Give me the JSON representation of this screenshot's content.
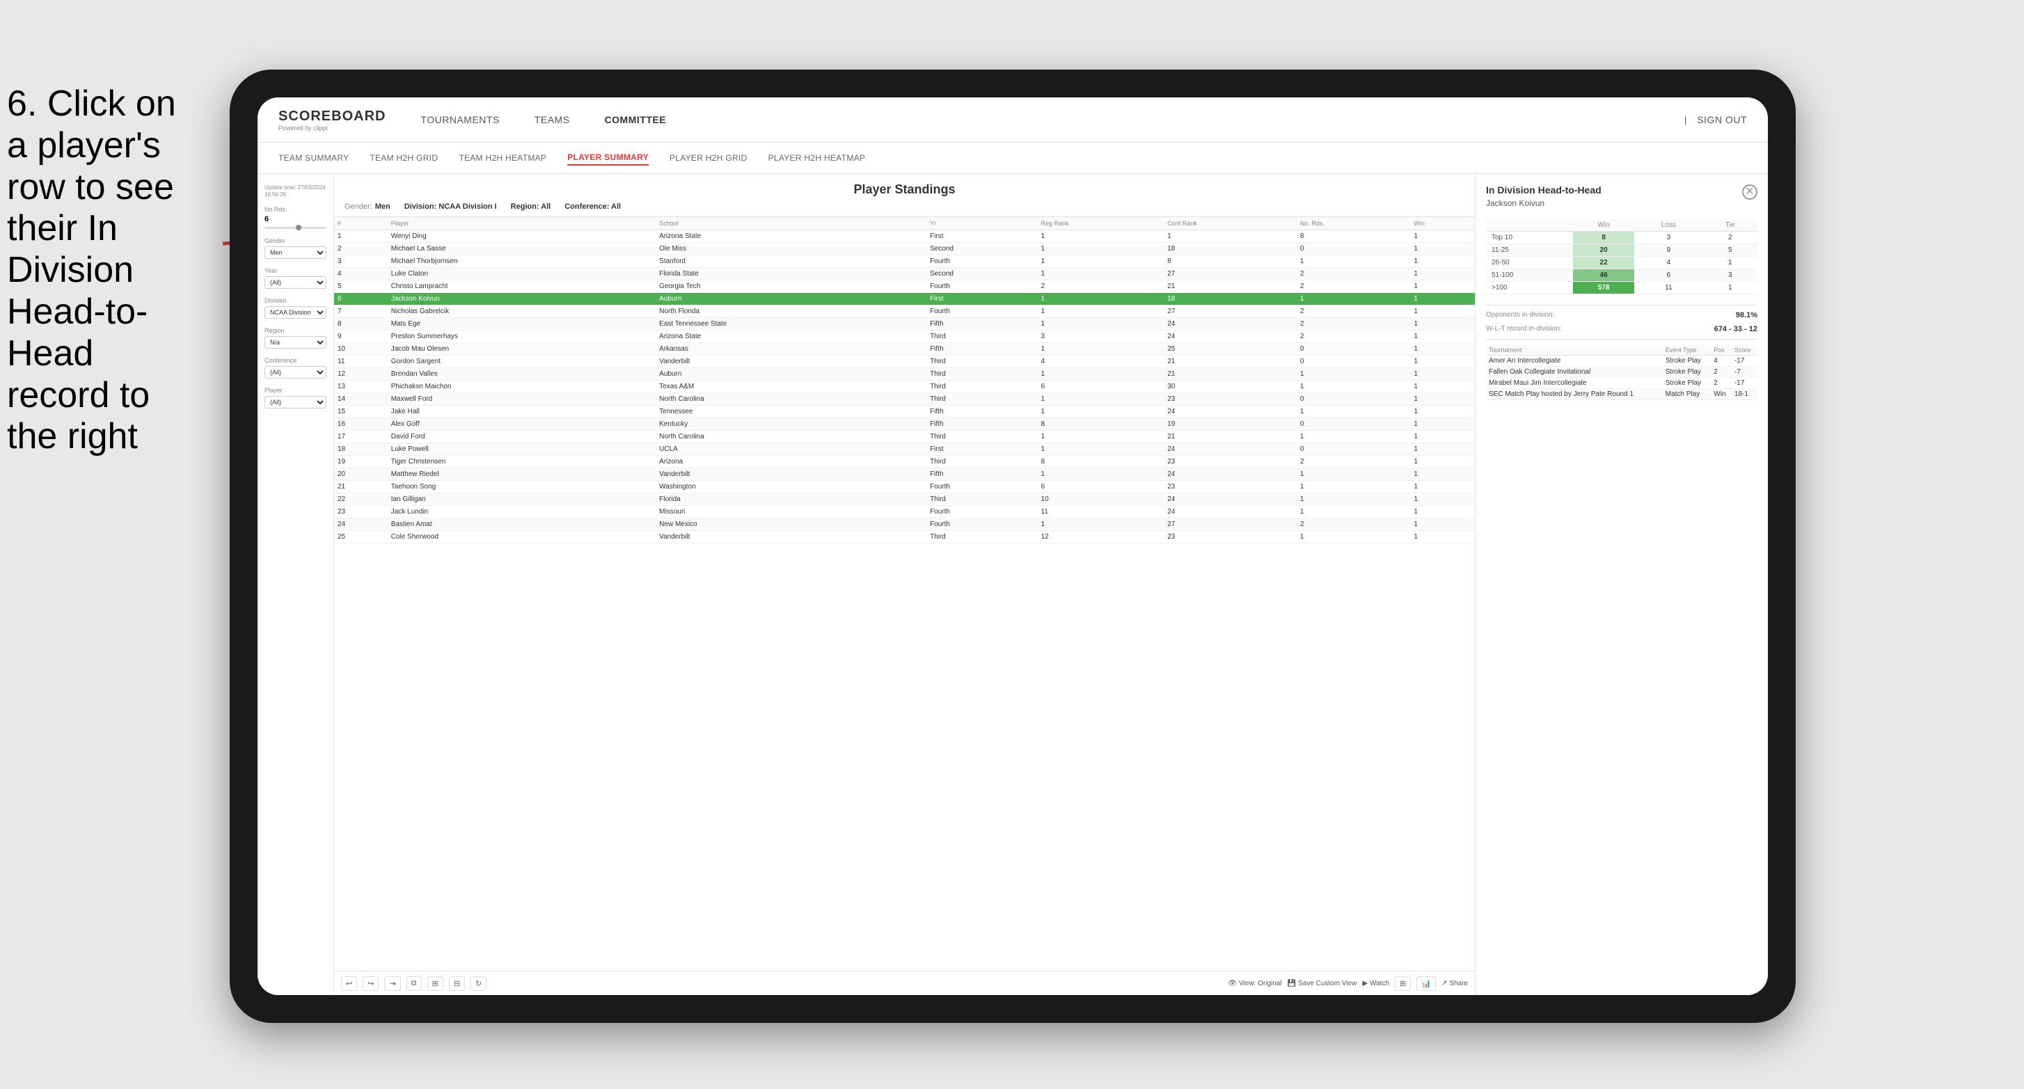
{
  "instruction": {
    "text": "6. Click on a player's row to see their In Division Head-to-Head record to the right"
  },
  "nav": {
    "logo": "SCOREBOARD",
    "logo_sub": "Powered by clippi",
    "items": [
      "TOURNAMENTS",
      "TEAMS",
      "COMMITTEE"
    ],
    "sign_in": "Sign out"
  },
  "sub_nav": {
    "items": [
      "TEAM SUMMARY",
      "TEAM H2H GRID",
      "TEAM H2H HEATMAP",
      "PLAYER SUMMARY",
      "PLAYER H2H GRID",
      "PLAYER H2H HEATMAP"
    ],
    "active": "PLAYER SUMMARY"
  },
  "filter": {
    "update_time": "Update time:\n27/03/2024 16:56:26",
    "no_rds_label": "No Rds.",
    "no_rds_value": "6",
    "gender_label": "Gender",
    "gender_value": "Men",
    "year_label": "Year",
    "year_value": "(All)",
    "division_label": "Division",
    "division_value": "NCAA Division I",
    "region_label": "Region",
    "region_value": "N/a",
    "conference_label": "Conference",
    "conference_value": "(All)",
    "player_label": "Player",
    "player_value": "(All)"
  },
  "standings": {
    "title": "Player Standings",
    "gender_label": "Gender:",
    "gender_value": "Men",
    "division_label": "Division: NCAA Division I",
    "region_label": "Region: All",
    "conference_label": "Conference: All",
    "columns": [
      "#",
      "Player",
      "School",
      "Yr",
      "Reg Rank",
      "Conf Rank",
      "No. Rds.",
      "Win"
    ],
    "rows": [
      {
        "num": 1,
        "player": "Wenyi Ding",
        "school": "Arizona State",
        "yr": "First",
        "reg": 1,
        "conf": 1,
        "rds": 8,
        "win": 1
      },
      {
        "num": 2,
        "player": "Michael La Sasse",
        "school": "Ole Miss",
        "yr": "Second",
        "reg": 1,
        "conf": 18,
        "rds": 0,
        "win": 1
      },
      {
        "num": 3,
        "player": "Michael Thorbjornsen",
        "school": "Stanford",
        "yr": "Fourth",
        "reg": 1,
        "conf": 8,
        "rds": 1,
        "win": 1
      },
      {
        "num": 4,
        "player": "Luke Claton",
        "school": "Florida State",
        "yr": "Second",
        "reg": 1,
        "conf": 27,
        "rds": 2,
        "win": 1
      },
      {
        "num": 5,
        "player": "Christo Lampracht",
        "school": "Georgia Tech",
        "yr": "Fourth",
        "reg": 2,
        "conf": 21,
        "rds": 2,
        "win": 1
      },
      {
        "num": 6,
        "player": "Jackson Koivun",
        "school": "Auburn",
        "yr": "First",
        "reg": 1,
        "conf": 18,
        "rds": 1,
        "win": 1,
        "highlighted": true
      },
      {
        "num": 7,
        "player": "Nicholas Gabrelcik",
        "school": "North Florida",
        "yr": "Fourth",
        "reg": 1,
        "conf": 27,
        "rds": 2,
        "win": 1
      },
      {
        "num": 8,
        "player": "Mats Ege",
        "school": "East Tennessee State",
        "yr": "Fifth",
        "reg": 1,
        "conf": 24,
        "rds": 2,
        "win": 1
      },
      {
        "num": 9,
        "player": "Preston Summerhays",
        "school": "Arizona State",
        "yr": "Third",
        "reg": 3,
        "conf": 24,
        "rds": 2,
        "win": 1
      },
      {
        "num": 10,
        "player": "Jacob Mau Olesen",
        "school": "Arkansas",
        "yr": "Fifth",
        "reg": 1,
        "conf": 25,
        "rds": 0,
        "win": 1
      },
      {
        "num": 11,
        "player": "Gordon Sargent",
        "school": "Vanderbilt",
        "yr": "Third",
        "reg": 4,
        "conf": 21,
        "rds": 0,
        "win": 1
      },
      {
        "num": 12,
        "player": "Brendan Valles",
        "school": "Auburn",
        "yr": "Third",
        "reg": 1,
        "conf": 21,
        "rds": 1,
        "win": 1
      },
      {
        "num": 13,
        "player": "Phichaksn Maichon",
        "school": "Texas A&M",
        "yr": "Third",
        "reg": 6,
        "conf": 30,
        "rds": 1,
        "win": 1
      },
      {
        "num": 14,
        "player": "Maxwell Ford",
        "school": "North Carolina",
        "yr": "Third",
        "reg": 1,
        "conf": 23,
        "rds": 0,
        "win": 1
      },
      {
        "num": 15,
        "player": "Jake Hall",
        "school": "Tennessee",
        "yr": "Fifth",
        "reg": 1,
        "conf": 24,
        "rds": 1,
        "win": 1
      },
      {
        "num": 16,
        "player": "Alex Goff",
        "school": "Kentucky",
        "yr": "Fifth",
        "reg": 8,
        "conf": 19,
        "rds": 0,
        "win": 1
      },
      {
        "num": 17,
        "player": "David Ford",
        "school": "North Carolina",
        "yr": "Third",
        "reg": 1,
        "conf": 21,
        "rds": 1,
        "win": 1
      },
      {
        "num": 18,
        "player": "Luke Powell",
        "school": "UCLA",
        "yr": "First",
        "reg": 1,
        "conf": 24,
        "rds": 0,
        "win": 1
      },
      {
        "num": 19,
        "player": "Tiger Christensen",
        "school": "Arizona",
        "yr": "Third",
        "reg": 8,
        "conf": 23,
        "rds": 2,
        "win": 1
      },
      {
        "num": 20,
        "player": "Matthew Riedel",
        "school": "Vanderbilt",
        "yr": "Fifth",
        "reg": 1,
        "conf": 24,
        "rds": 1,
        "win": 1
      },
      {
        "num": 21,
        "player": "Taehoon Song",
        "school": "Washington",
        "yr": "Fourth",
        "reg": 6,
        "conf": 23,
        "rds": 1,
        "win": 1
      },
      {
        "num": 22,
        "player": "Ian Gilligan",
        "school": "Florida",
        "yr": "Third",
        "reg": 10,
        "conf": 24,
        "rds": 1,
        "win": 1
      },
      {
        "num": 23,
        "player": "Jack Lundin",
        "school": "Missouri",
        "yr": "Fourth",
        "reg": 11,
        "conf": 24,
        "rds": 1,
        "win": 1
      },
      {
        "num": 24,
        "player": "Bastien Amat",
        "school": "New Mexico",
        "yr": "Fourth",
        "reg": 1,
        "conf": 27,
        "rds": 2,
        "win": 1
      },
      {
        "num": 25,
        "player": "Cole Sherwood",
        "school": "Vanderbilt",
        "yr": "Third",
        "reg": 12,
        "conf": 23,
        "rds": 1,
        "win": 1
      }
    ]
  },
  "h2h": {
    "title": "In Division Head-to-Head",
    "player": "Jackson Koivun",
    "table_headers": [
      "",
      "Win",
      "Loss",
      "Tie"
    ],
    "rows": [
      {
        "label": "Top 10",
        "win": 8,
        "loss": 3,
        "tie": 2,
        "win_color": "light-green"
      },
      {
        "label": "11-25",
        "win": 20,
        "loss": 9,
        "tie": 5,
        "win_color": "light-green"
      },
      {
        "label": "26-50",
        "win": 22,
        "loss": 4,
        "tie": 1,
        "win_color": "light-green"
      },
      {
        "label": "51-100",
        "win": 46,
        "loss": 6,
        "tie": 3,
        "win_color": "green"
      },
      {
        "label": ">100",
        "win": 578,
        "loss": 11,
        "tie": 1,
        "win_color": "bright-green"
      }
    ],
    "opponents_label": "Opponents in division:",
    "opponents_value": "98.1%",
    "wlt_label": "W-L-T record in-division:",
    "wlt_value": "674 - 33 - 12",
    "tournament_cols": [
      "Tournament",
      "Event Type",
      "Pos",
      "Score"
    ],
    "tournaments": [
      {
        "name": "Amer Ari Intercollegiate",
        "type": "Stroke Play",
        "pos": 4,
        "score": "-17"
      },
      {
        "name": "Fallen Oak Collegiate Invitational",
        "type": "Stroke Play",
        "pos": 2,
        "score": "-7"
      },
      {
        "name": "Mirabel Maui Jim Intercollegiate",
        "type": "Stroke Play",
        "pos": 2,
        "score": "-17"
      },
      {
        "name": "SEC Match Play hosted by Jerry Pate Round 1",
        "type": "Match Play",
        "pos": "Win",
        "score": "18-1"
      }
    ]
  },
  "toolbar": {
    "view_original": "View: Original",
    "save_custom": "Save Custom View",
    "watch": "Watch",
    "share": "Share"
  }
}
